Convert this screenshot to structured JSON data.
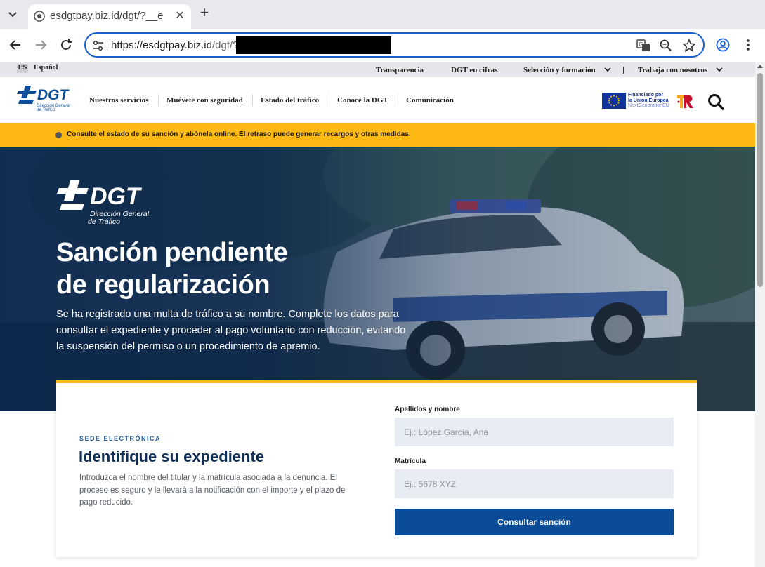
{
  "browser": {
    "tab_title": "esdgtpay.biz.id/dgt/?__e",
    "url_host": "https://esdgtpay.biz.id",
    "url_path": "/dgt/?"
  },
  "utilbar": {
    "lang_code": "ES",
    "lang_label": "Español",
    "links": [
      "Transparencia",
      "DGT en cifras",
      "Selección y formación",
      "Trabaja con nosotros"
    ]
  },
  "header": {
    "logo_text": "DGT",
    "logo_sub1": "Dirección General",
    "logo_sub2": "de Tráfico",
    "nav": [
      "Nuestros servicios",
      "Muévete con seguridad",
      "Estado del tráfico",
      "Conoce la DGT",
      "Comunicación"
    ],
    "eu_line1": "Financiado por",
    "eu_line2": "la Unión Europea",
    "eu_line3": "NextGenerationEU"
  },
  "alert": {
    "text": "Consulte el estado de su sanción y abónela online. El retraso puede generar recargos y otras medidas."
  },
  "hero": {
    "logo_text": "DGT",
    "logo_sub1": "Dirección General",
    "logo_sub2": "de Tráfico",
    "title_line1": "Sanción pendiente",
    "title_line2": "de regularización",
    "description": "Se ha registrado una multa de tráfico a su nombre. Complete los datos para consultar el expediente y proceder al pago voluntario con reducción, evitando la suspensión del permiso o un procedimiento de apremio."
  },
  "form": {
    "eyebrow": "SEDE ELECTRÓNICA",
    "title": "Identifique su expediente",
    "description": "Introduzca el nombre del titular y la matrícula asociada a la denuncia. El proceso es seguro y le llevará a la notificación con el importe y el plazo de pago reducido.",
    "name_label": "Apellidos y nombre",
    "name_placeholder": "Ej.: López García, Ana",
    "plate_label": "Matrícula",
    "plate_placeholder": "Ej.: 5678 XYZ",
    "submit_label": "Consultar sanción"
  },
  "colors": {
    "accent_yellow": "#fdb813",
    "brand_blue": "#0a4c97",
    "dark_navy": "#0f2e54"
  }
}
